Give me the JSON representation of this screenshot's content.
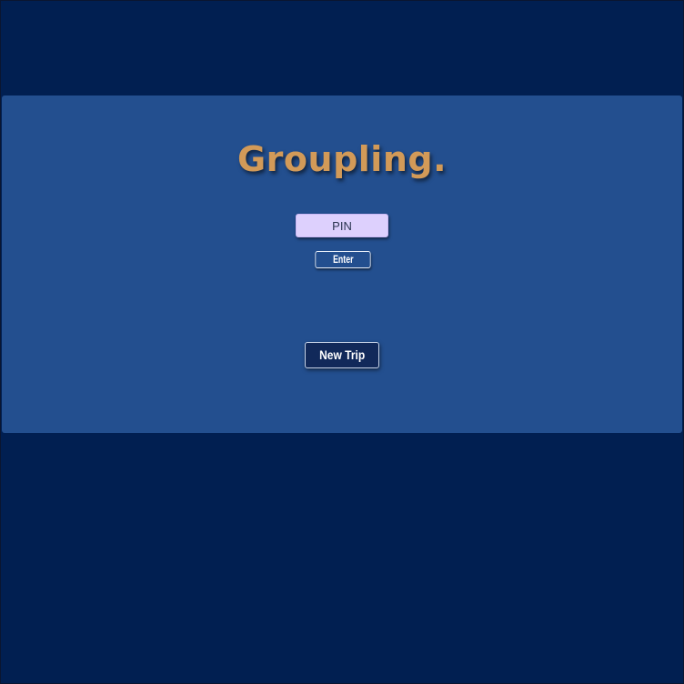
{
  "app": {
    "title": "Groupling."
  },
  "join": {
    "pin_placeholder": "PIN",
    "pin_value": "",
    "enter_label": "Enter"
  },
  "create": {
    "new_trip_label": "New Trip"
  },
  "colors": {
    "background": "#011f51",
    "panel": "#234f8f",
    "title": "#d29a58",
    "pin_field": "#ddd0fd",
    "new_trip_button": "#11295a"
  }
}
